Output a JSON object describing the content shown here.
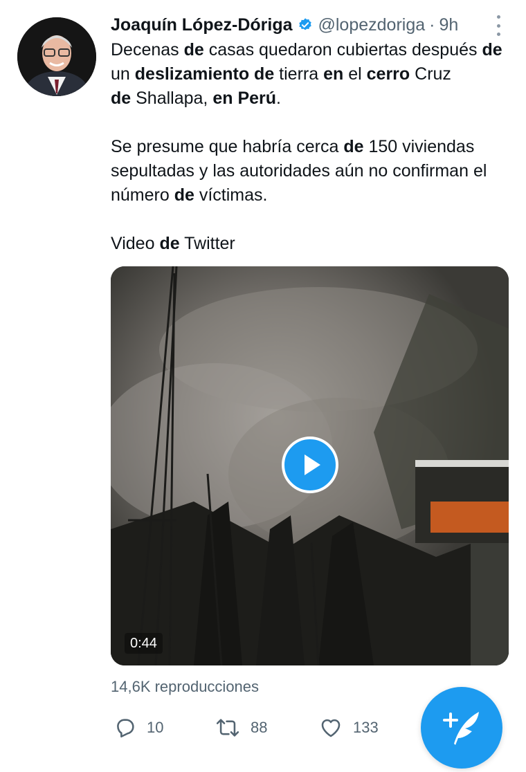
{
  "tweet": {
    "author_name": "Joaquín López-Dóriga",
    "handle": "@lopezdoriga",
    "separator": "·",
    "time": "9h",
    "p1": [
      "Decenas ",
      "de",
      " casas quedaron cubiertas después ",
      "de",
      " un ",
      "deslizamiento",
      " ",
      "de",
      " tierra ",
      "en",
      " el ",
      "cerro",
      " Cruz ",
      "de",
      " Shallapa, ",
      "en Perú",
      "."
    ],
    "p2": [
      "Se presume que habría cerca ",
      "de",
      " 150 viviendas sepultadas y las autoridades aún no confirman el número ",
      "de",
      " víctimas."
    ],
    "p3": [
      "Video ",
      "de",
      " Twitter"
    ]
  },
  "media": {
    "duration": "0:44",
    "views": "14,6K reproducciones"
  },
  "actions": {
    "replies": "10",
    "retweets": "88",
    "likes": "133"
  },
  "icons": {
    "verified": "verified-badge-icon",
    "more": "more-vertical-icon",
    "play": "play-icon",
    "reply": "reply-icon",
    "retweet": "retweet-icon",
    "like": "heart-icon",
    "compose": "compose-tweet-icon"
  },
  "colors": {
    "accent": "#1d9bf0",
    "secondary_text": "#536471"
  }
}
